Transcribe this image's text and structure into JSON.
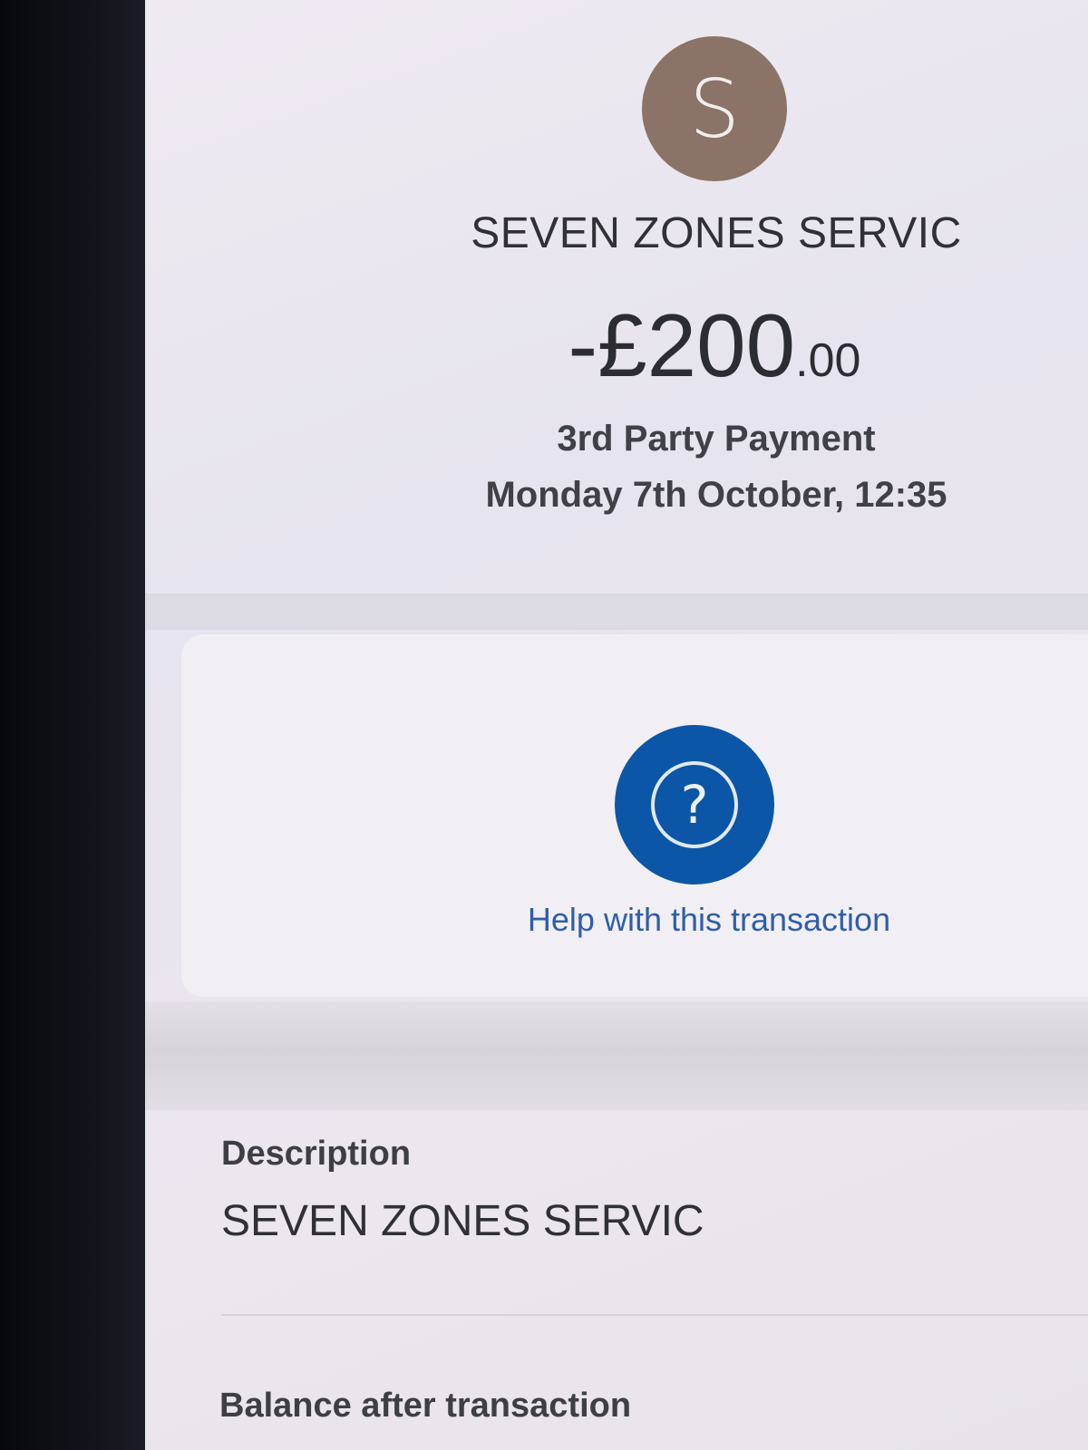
{
  "transaction": {
    "avatar_letter": "S",
    "merchant_name": "SEVEN ZONES SERVIC",
    "amount_main": "-£200",
    "amount_pence": ".00",
    "type": "3rd Party Payment",
    "datetime": "Monday 7th October, 12:35"
  },
  "help": {
    "icon": "question-icon",
    "icon_glyph": "?",
    "label": "Help with this transaction"
  },
  "details": {
    "description_label": "Description",
    "description_value": "SEVEN ZONES SERVIC",
    "balance_label": "Balance after transaction"
  },
  "colors": {
    "avatar": "#8b7367",
    "help_button": "#0b56a6",
    "link": "#2f5ea8"
  }
}
